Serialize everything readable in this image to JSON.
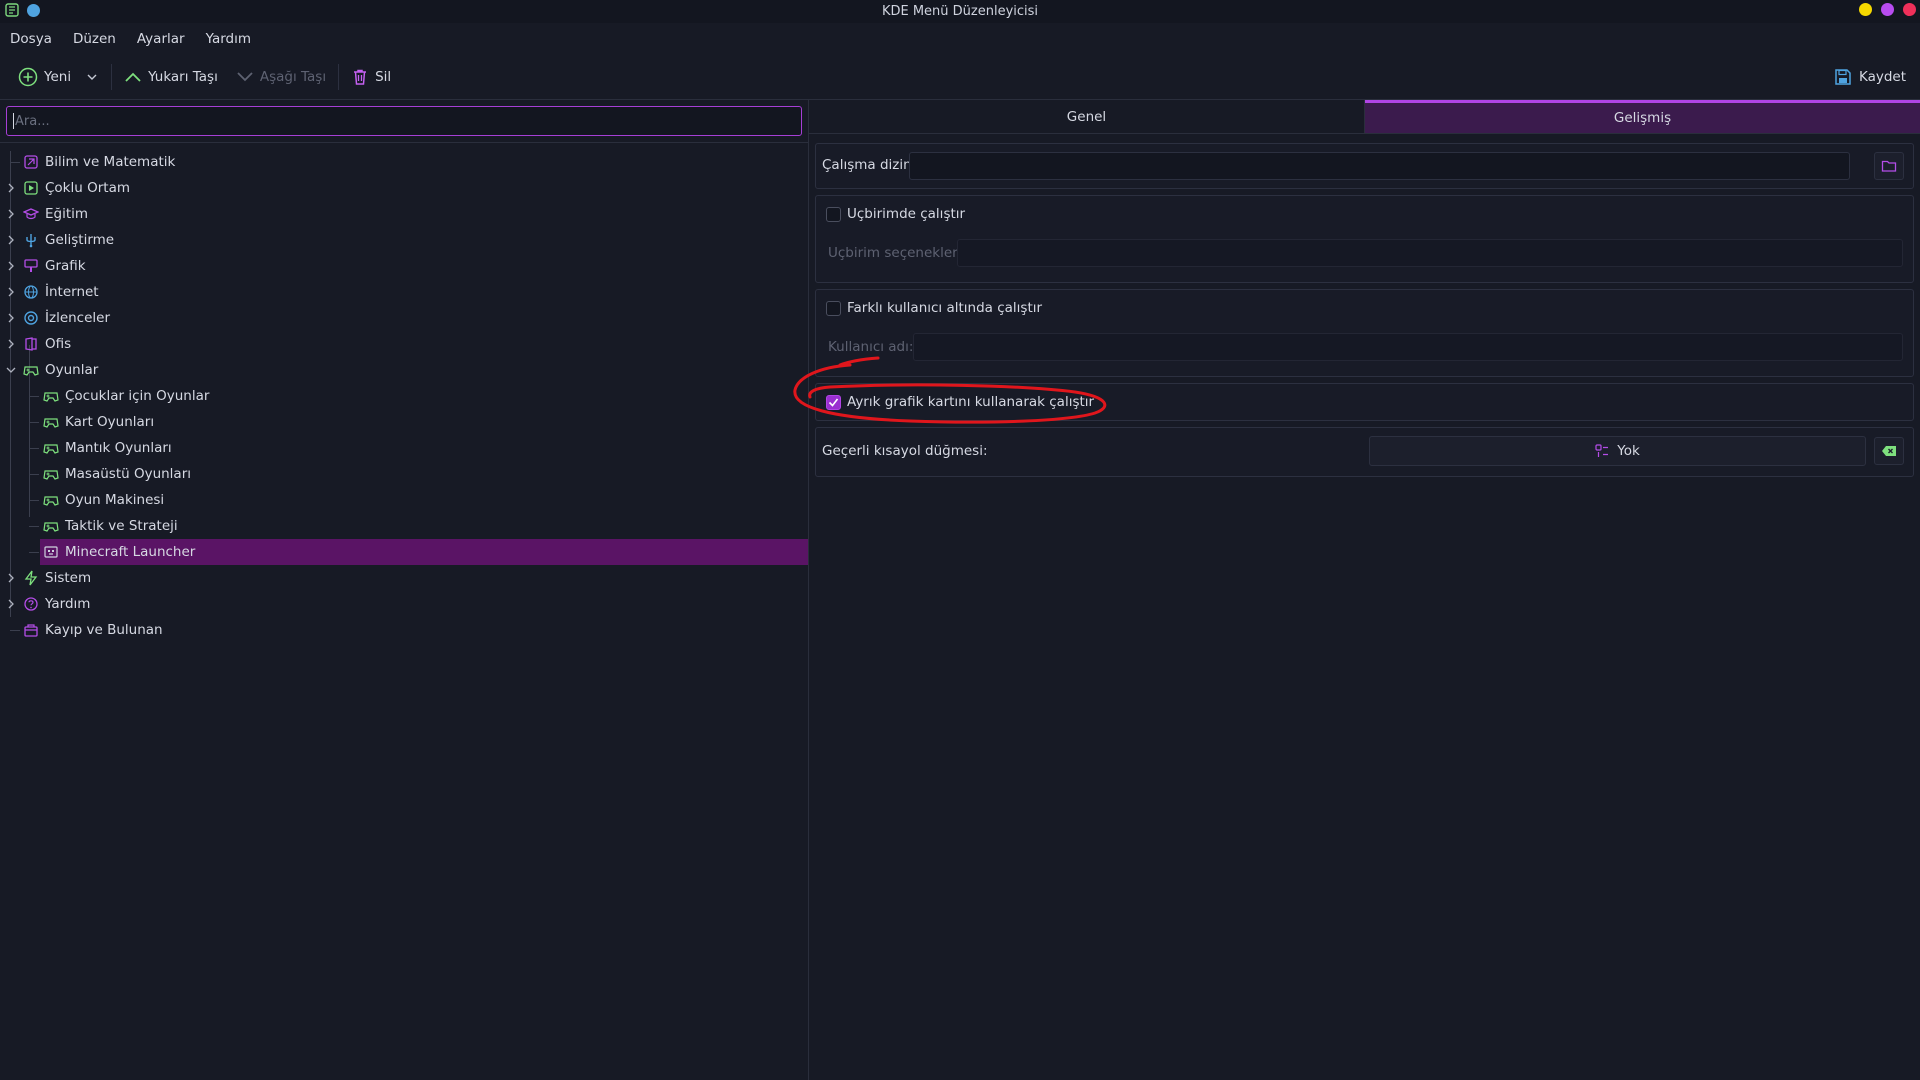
{
  "window": {
    "title": "KDE Menü Düzenleyicisi",
    "controls": [
      {
        "name": "minimize",
        "color": "#f5d800"
      },
      {
        "name": "maximize",
        "color": "#b84cf0"
      },
      {
        "name": "close",
        "color": "#f0305a"
      }
    ]
  },
  "menubar": [
    "Dosya",
    "Düzen",
    "Ayarlar",
    "Yardım"
  ],
  "toolbar": {
    "new_label": "Yeni",
    "move_up_label": "Yukarı Taşı",
    "move_down_label": "Aşağı Taşı",
    "delete_label": "Sil",
    "save_label": "Kaydet"
  },
  "search": {
    "placeholder": "Ara...",
    "value": ""
  },
  "tree": {
    "items": [
      {
        "label": "Bilim ve Matematik",
        "icon": "science-icon",
        "expandable": false
      },
      {
        "label": "Çoklu Ortam",
        "icon": "multimedia-icon",
        "expandable": true
      },
      {
        "label": "Eğitim",
        "icon": "education-icon",
        "expandable": true
      },
      {
        "label": "Geliştirme",
        "icon": "development-icon",
        "expandable": true
      },
      {
        "label": "Grafik",
        "icon": "graphics-icon",
        "expandable": true
      },
      {
        "label": "İnternet",
        "icon": "internet-icon",
        "expandable": true
      },
      {
        "label": "İzlenceler",
        "icon": "utilities-icon",
        "expandable": true
      },
      {
        "label": "Ofis",
        "icon": "office-icon",
        "expandable": true
      },
      {
        "label": "Oyunlar",
        "icon": "games-icon",
        "expandable": true,
        "expanded": true
      },
      {
        "label": "Sistem",
        "icon": "system-icon",
        "expandable": true
      },
      {
        "label": "Yardım",
        "icon": "help-icon",
        "expandable": true
      },
      {
        "label": "Kayıp ve Bulunan",
        "icon": "lost-found-icon",
        "expandable": false
      }
    ],
    "games_children": [
      {
        "label": "Çocuklar için Oyunlar",
        "icon": "gamepad-icon"
      },
      {
        "label": "Kart Oyunları",
        "icon": "gamepad-icon"
      },
      {
        "label": "Mantık Oyunları",
        "icon": "gamepad-icon"
      },
      {
        "label": "Masaüstü Oyunları",
        "icon": "gamepad-icon"
      },
      {
        "label": "Oyun Makinesi",
        "icon": "gamepad-icon"
      },
      {
        "label": "Taktik ve Strateji",
        "icon": "gamepad-icon"
      },
      {
        "label": "Minecraft Launcher",
        "icon": "minecraft-icon",
        "selected": true
      }
    ]
  },
  "tabs": [
    {
      "label": "Genel",
      "active": false
    },
    {
      "label": "Gelişmiş",
      "active": true
    }
  ],
  "advanced": {
    "workdir_label": "Çalışma dizini:",
    "workdir_value": "",
    "terminal_label": "Uçbirimde çalıştır",
    "terminal_checked": false,
    "terminal_options_label": "Uçbirim seçenekleri:",
    "terminal_options_value": "",
    "other_user_label": "Farklı kullanıcı altında çalıştır",
    "other_user_checked": false,
    "username_label": "Kullanıcı adı:",
    "username_value": "",
    "gpu_label": "Ayrık grafik kartını kullanarak çalıştır",
    "gpu_checked": true,
    "shortcut_label": "Geçerli kısayol düğmesi:",
    "shortcut_value": "Yok"
  },
  "colors": {
    "accent": "#b144e6",
    "selection": "#5a1465",
    "background": "#171a25",
    "annotation": "#e0161c"
  }
}
